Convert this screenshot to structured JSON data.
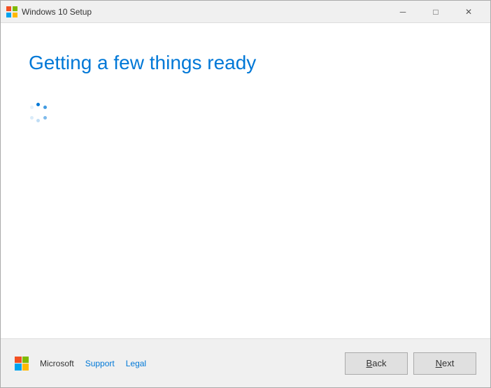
{
  "window": {
    "title": "Windows 10 Setup"
  },
  "titlebar": {
    "minimize_label": "─",
    "maximize_label": "□",
    "close_label": "✕"
  },
  "main": {
    "heading": "Getting a few things ready"
  },
  "footer": {
    "brand_name": "Microsoft",
    "support_link": "Support",
    "legal_link": "Legal",
    "back_button": "Back",
    "next_button": "Next"
  }
}
